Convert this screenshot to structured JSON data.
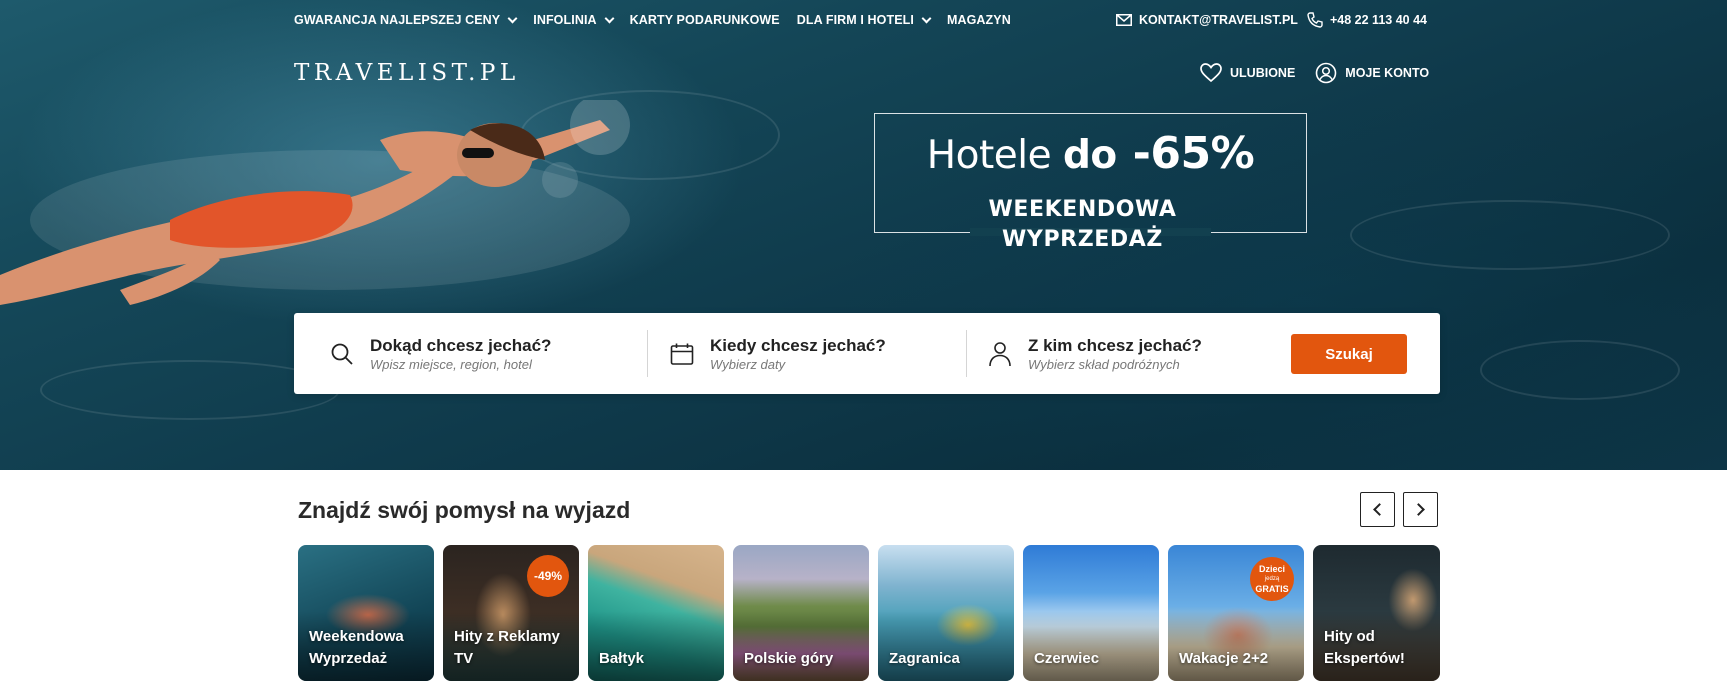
{
  "topnav": {
    "items": [
      {
        "label": "GWARANCJA NAJLEPSZEJ CENY",
        "dropdown": true
      },
      {
        "label": "INFOLINIA",
        "dropdown": true
      },
      {
        "label": "KARTY PODARUNKOWE",
        "dropdown": false
      },
      {
        "label": "DLA FIRM I HOTELI",
        "dropdown": true
      },
      {
        "label": "MAGAZYN",
        "dropdown": false
      }
    ],
    "email": "KONTAKT@TRAVELIST.PL",
    "phone": "+48 22 113 40 44"
  },
  "header": {
    "logo": "TRAVELIST.PL",
    "favorites_label": "ULUBIONE",
    "account_label": "MOJE KONTO"
  },
  "promo": {
    "title_prefix": "Hotele",
    "title_mid": "do",
    "title_value": "-65%",
    "subtitle_line1": "WEEKENDOWA",
    "subtitle_line2": "WYPRZEDAŻ"
  },
  "search": {
    "where_title": "Dokąd chcesz jechać?",
    "where_sub": "Wpisz miejsce, region, hotel",
    "when_title": "Kiedy chcesz jechać?",
    "when_sub": "Wybierz daty",
    "who_title": "Z kim chcesz jechać?",
    "who_sub": "Wybierz skład podróżnych",
    "button": "Szukaj"
  },
  "ideas": {
    "title": "Znajdź swój pomysł na wyjazd",
    "cards": [
      {
        "label": "Weekendowa Wyprzedaż"
      },
      {
        "label": "Hity z Reklamy TV",
        "badge": "-49%"
      },
      {
        "label": "Bałtyk"
      },
      {
        "label": "Polskie góry"
      },
      {
        "label": "Zagranica"
      },
      {
        "label": "Czerwiec"
      },
      {
        "label": "Wakacje 2+2",
        "badge_line1": "Dzieci",
        "badge_line2": "jedzą",
        "badge_line3": "GRATIS"
      },
      {
        "label": "Hity od Ekspertów!"
      }
    ]
  },
  "colors": {
    "accent": "#e2560e",
    "hero_water": "#0f3a4b"
  }
}
